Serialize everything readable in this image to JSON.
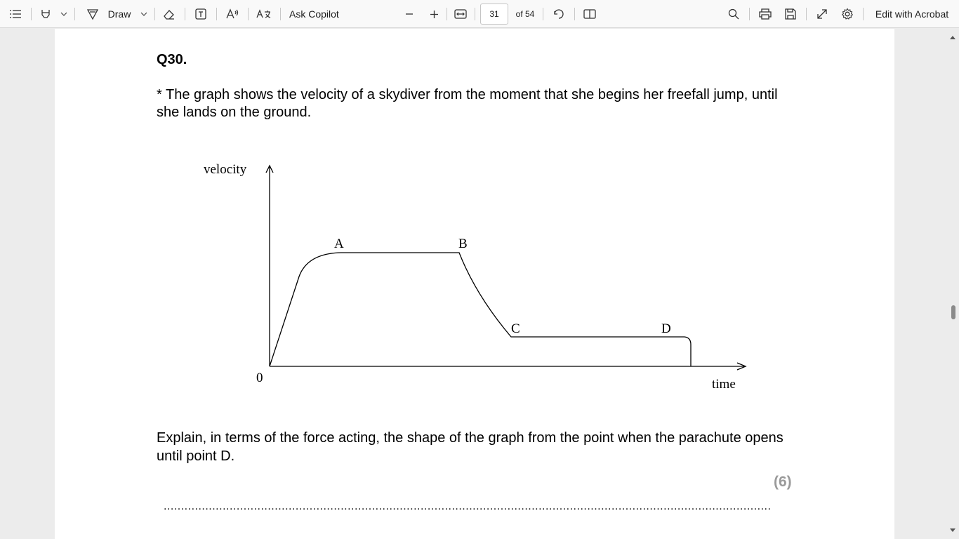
{
  "toolbar": {
    "draw_label": "Draw",
    "ask_copilot_label": "Ask Copilot",
    "page_number": "31",
    "page_total": "of 54",
    "edit_label": "Edit with Acrobat"
  },
  "document": {
    "question_number": "Q30.",
    "question_text": "* The graph shows the velocity of a skydiver from the moment that she begins her freefall jump, until she lands on the ground.",
    "explain_text": "Explain, in terms of the force acting, the shape of the graph from the point when the parachute opens until point D.",
    "marks": "(6)",
    "answer_line": "................................................................................................................................................................................................................................"
  },
  "graph": {
    "y_axis_label": "velocity",
    "x_axis_label": "time",
    "origin_label": "0",
    "point_labels": [
      "A",
      "B",
      "C",
      "D"
    ]
  }
}
